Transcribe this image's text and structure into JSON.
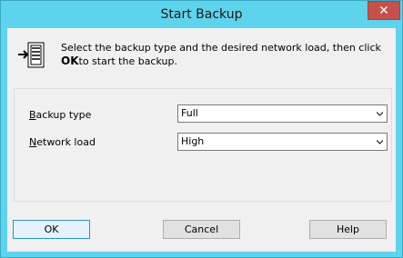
{
  "window": {
    "title": "Start Backup",
    "close_glyph": "✕"
  },
  "header": {
    "icon": "backup-transfer-icon",
    "text_before": "Select the backup type and the desired network load, then click ",
    "text_bold": "OK",
    "text_after": "to start the backup."
  },
  "fields": {
    "backup_type": {
      "label_mnemonic": "B",
      "label_rest": "ackup type",
      "value": "Full"
    },
    "network_load": {
      "label_mnemonic": "N",
      "label_rest": "etwork load",
      "value": "High"
    }
  },
  "buttons": {
    "ok": "OK",
    "cancel": "Cancel",
    "help": "Help"
  },
  "colors": {
    "title_bar": "#5ed3ec",
    "close_button": "#c7504a",
    "dialog_face": "#f0f0f0",
    "default_button_border": "#2f8fce"
  }
}
